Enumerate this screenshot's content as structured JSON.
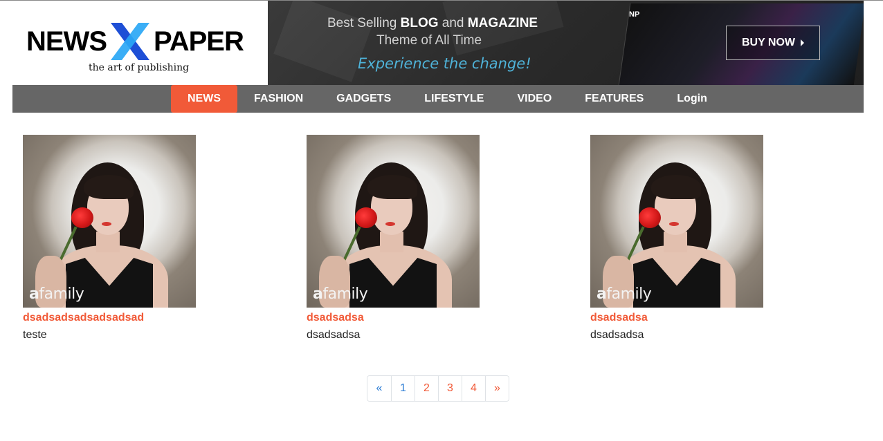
{
  "logo": {
    "word_left": "NEWS",
    "word_right": "PAPER",
    "tagline": "the art of publishing",
    "x_colors": [
      "#1e4fd6",
      "#2aa7f5"
    ]
  },
  "banner": {
    "line1_prefix": "Best Selling ",
    "line1_bold1": "BLOG",
    "line1_mid": " and ",
    "line1_bold2": "MAGAZINE",
    "line2": "Theme of All Time",
    "line3": "Experience the change!",
    "np_badge": "NP",
    "buy_label": "BUY NOW"
  },
  "nav": {
    "items": [
      {
        "label": "NEWS",
        "active": true
      },
      {
        "label": "FASHION"
      },
      {
        "label": "GADGETS"
      },
      {
        "label": "LIFESTYLE"
      },
      {
        "label": "VIDEO"
      },
      {
        "label": "FEATURES"
      },
      {
        "label": "Login"
      }
    ]
  },
  "watermark": {
    "bold": "a",
    "rest": "family"
  },
  "cards": [
    {
      "title": "dsadsadsadsadsadsad",
      "description": "teste"
    },
    {
      "title": "dsadsadsa",
      "description": "dsadsadsa"
    },
    {
      "title": "dsadsadsa",
      "description": "dsadsadsa"
    }
  ],
  "pagination": {
    "prev": "«",
    "pages": [
      "1",
      "2",
      "3",
      "4"
    ],
    "next": "»",
    "current": "1"
  },
  "colors": {
    "accent": "#f15a38",
    "nav_bg": "#666666",
    "link_blue": "#2a7bd4"
  }
}
